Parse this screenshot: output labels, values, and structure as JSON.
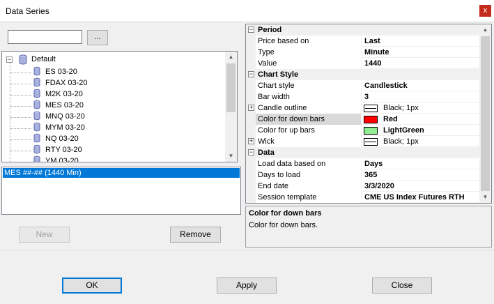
{
  "window": {
    "title": "Data Series",
    "close_glyph": "x"
  },
  "search": {
    "value": "",
    "browse_label": "..."
  },
  "tree": {
    "root_label": "Default",
    "items": [
      "ES 03-20",
      "FDAX 03-20",
      "M2K 03-20",
      "MES 03-20",
      "MNQ 03-20",
      "MYM 03-20",
      "NQ 03-20",
      "RTY 03-20",
      "YM 03-20"
    ]
  },
  "series_list": {
    "items": [
      "MES ##-## (1440 Min)"
    ]
  },
  "buttons": {
    "new": "New",
    "remove": "Remove",
    "ok": "OK",
    "apply": "Apply",
    "close": "Close"
  },
  "properties": {
    "period": {
      "category": "Period",
      "rows": [
        {
          "name": "Price based on",
          "value": "Last"
        },
        {
          "name": "Type",
          "value": "Minute"
        },
        {
          "name": "Value",
          "value": "1440"
        }
      ]
    },
    "chart_style": {
      "category": "Chart Style",
      "chart_style": {
        "name": "Chart style",
        "value": "Candlestick"
      },
      "bar_width": {
        "name": "Bar width",
        "value": "3"
      },
      "candle_outline": {
        "name": "Candle outline",
        "value": "Black; 1px"
      },
      "color_down": {
        "name": "Color for down bars",
        "value": "Red",
        "color": "#ff0000"
      },
      "color_up": {
        "name": "Color for up bars",
        "value": "LightGreen",
        "color": "#90ee90"
      },
      "wick": {
        "name": "Wick",
        "value": "Black; 1px"
      }
    },
    "data": {
      "category": "Data",
      "rows": [
        {
          "name": "Load data based on",
          "value": "Days"
        },
        {
          "name": "Days to load",
          "value": "365"
        },
        {
          "name": "End date",
          "value": "3/3/2020"
        },
        {
          "name": "Session template",
          "value": "CME US Index Futures RTH"
        }
      ]
    }
  },
  "description": {
    "title": "Color for down bars",
    "text": "Color for down bars."
  }
}
